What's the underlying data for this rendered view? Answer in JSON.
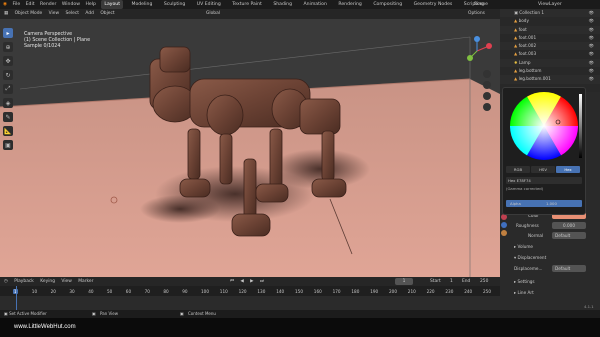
{
  "topbar": {
    "menus": [
      "File",
      "Edit",
      "Render",
      "Window",
      "Help"
    ],
    "workspaces": [
      "Layout",
      "Modeling",
      "Sculpting",
      "UV Editing",
      "Texture Paint",
      "Shading",
      "Animation",
      "Rendering",
      "Compositing",
      "Geometry Nodes",
      "Scripting"
    ],
    "active_workspace": "Layout",
    "scene_label": "Scene",
    "view_layer_label": "ViewLayer"
  },
  "viewport_header": {
    "mode": "Object Mode",
    "menus": [
      "View",
      "Select",
      "Add",
      "Object"
    ],
    "transform_orientation": "Global",
    "options_label": "Options"
  },
  "viewport_overlay": {
    "camera": "Camera Perspective",
    "collection": "(1) Scene Collection | Plane",
    "sample": "Sample 0/1024"
  },
  "toolbar": {
    "tools": [
      "select-icon",
      "cursor-icon",
      "move-icon",
      "rotate-icon",
      "scale-icon",
      "transform-icon",
      "annotate-icon",
      "measure-icon",
      "add-cube-icon"
    ]
  },
  "outliner": {
    "items": [
      {
        "label": "Collection 1"
      },
      {
        "label": "body"
      },
      {
        "label": "foot"
      },
      {
        "label": "foot.001"
      },
      {
        "label": "foot.002"
      },
      {
        "label": "foot.003"
      },
      {
        "label": "Lamp"
      },
      {
        "label": "leg.bottom"
      },
      {
        "label": "leg.bottom.001"
      }
    ]
  },
  "color_picker": {
    "modes": [
      "RGB",
      "HSV",
      "Hex"
    ],
    "active_mode": "Hex",
    "hex_value": "Hex E78F74",
    "gamma_note": "(Gamma corrected)",
    "alpha_label": "Alpha",
    "alpha_value": "1.000"
  },
  "properties": {
    "color_label": "Color",
    "color_swatch": "#e78f74",
    "roughness_label": "Roughness",
    "roughness_value": "0.000",
    "normal_label": "Normal",
    "normal_value": "Default",
    "volume_label": "Volume",
    "displacement_label": "Displacement",
    "displacement_field_label": "Displaceme...",
    "displacement_value": "Default",
    "settings_label": "Settings",
    "lineart_label": "Line Art"
  },
  "timeline": {
    "menus": [
      "Playback",
      "Keying",
      "View",
      "Marker"
    ],
    "current_frame": "1",
    "start_label": "Start",
    "start_value": "1",
    "end_label": "End",
    "end_value": "250",
    "ruler_ticks": [
      "1",
      "10",
      "20",
      "30",
      "40",
      "50",
      "60",
      "70",
      "80",
      "90",
      "100",
      "110",
      "120",
      "130",
      "140",
      "150",
      "160",
      "170",
      "180",
      "190",
      "200",
      "210",
      "220",
      "230",
      "240",
      "250"
    ]
  },
  "statusbar": {
    "left": "Set Active Modifier",
    "middle": "Pan View",
    "right": "Context Menu",
    "version": "4.1.1"
  },
  "footer": {
    "watermark": "www.LittleWebHut.com"
  },
  "colors": {
    "accent": "#4772b3",
    "floor": "#d9a093",
    "robot_rust": "#7a4a3a"
  }
}
